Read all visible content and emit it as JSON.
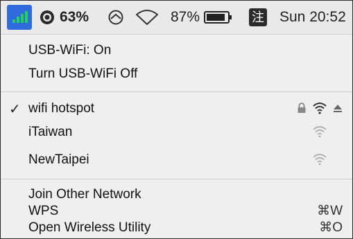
{
  "menubar": {
    "cpu_percent": "63%",
    "battery_percent": "87%",
    "input_method_char": "注",
    "clock": "Sun 20:52"
  },
  "menu": {
    "status": "USB-WiFi: On",
    "toggle": "Turn USB-WiFi Off",
    "networks": [
      {
        "name": "wifi hotspot",
        "checked": true,
        "locked": true,
        "eject": true
      },
      {
        "name": "iTaiwan",
        "checked": false,
        "locked": false,
        "eject": false
      },
      {
        "name": "NewTaipei",
        "checked": false,
        "locked": false,
        "eject": false
      }
    ],
    "check_mark": "✓",
    "join_other": "Join Other Network",
    "wps": "WPS",
    "wps_shortcut": "⌘W",
    "open_utility": "Open Wireless Utility",
    "open_utility_shortcut": "⌘O"
  }
}
